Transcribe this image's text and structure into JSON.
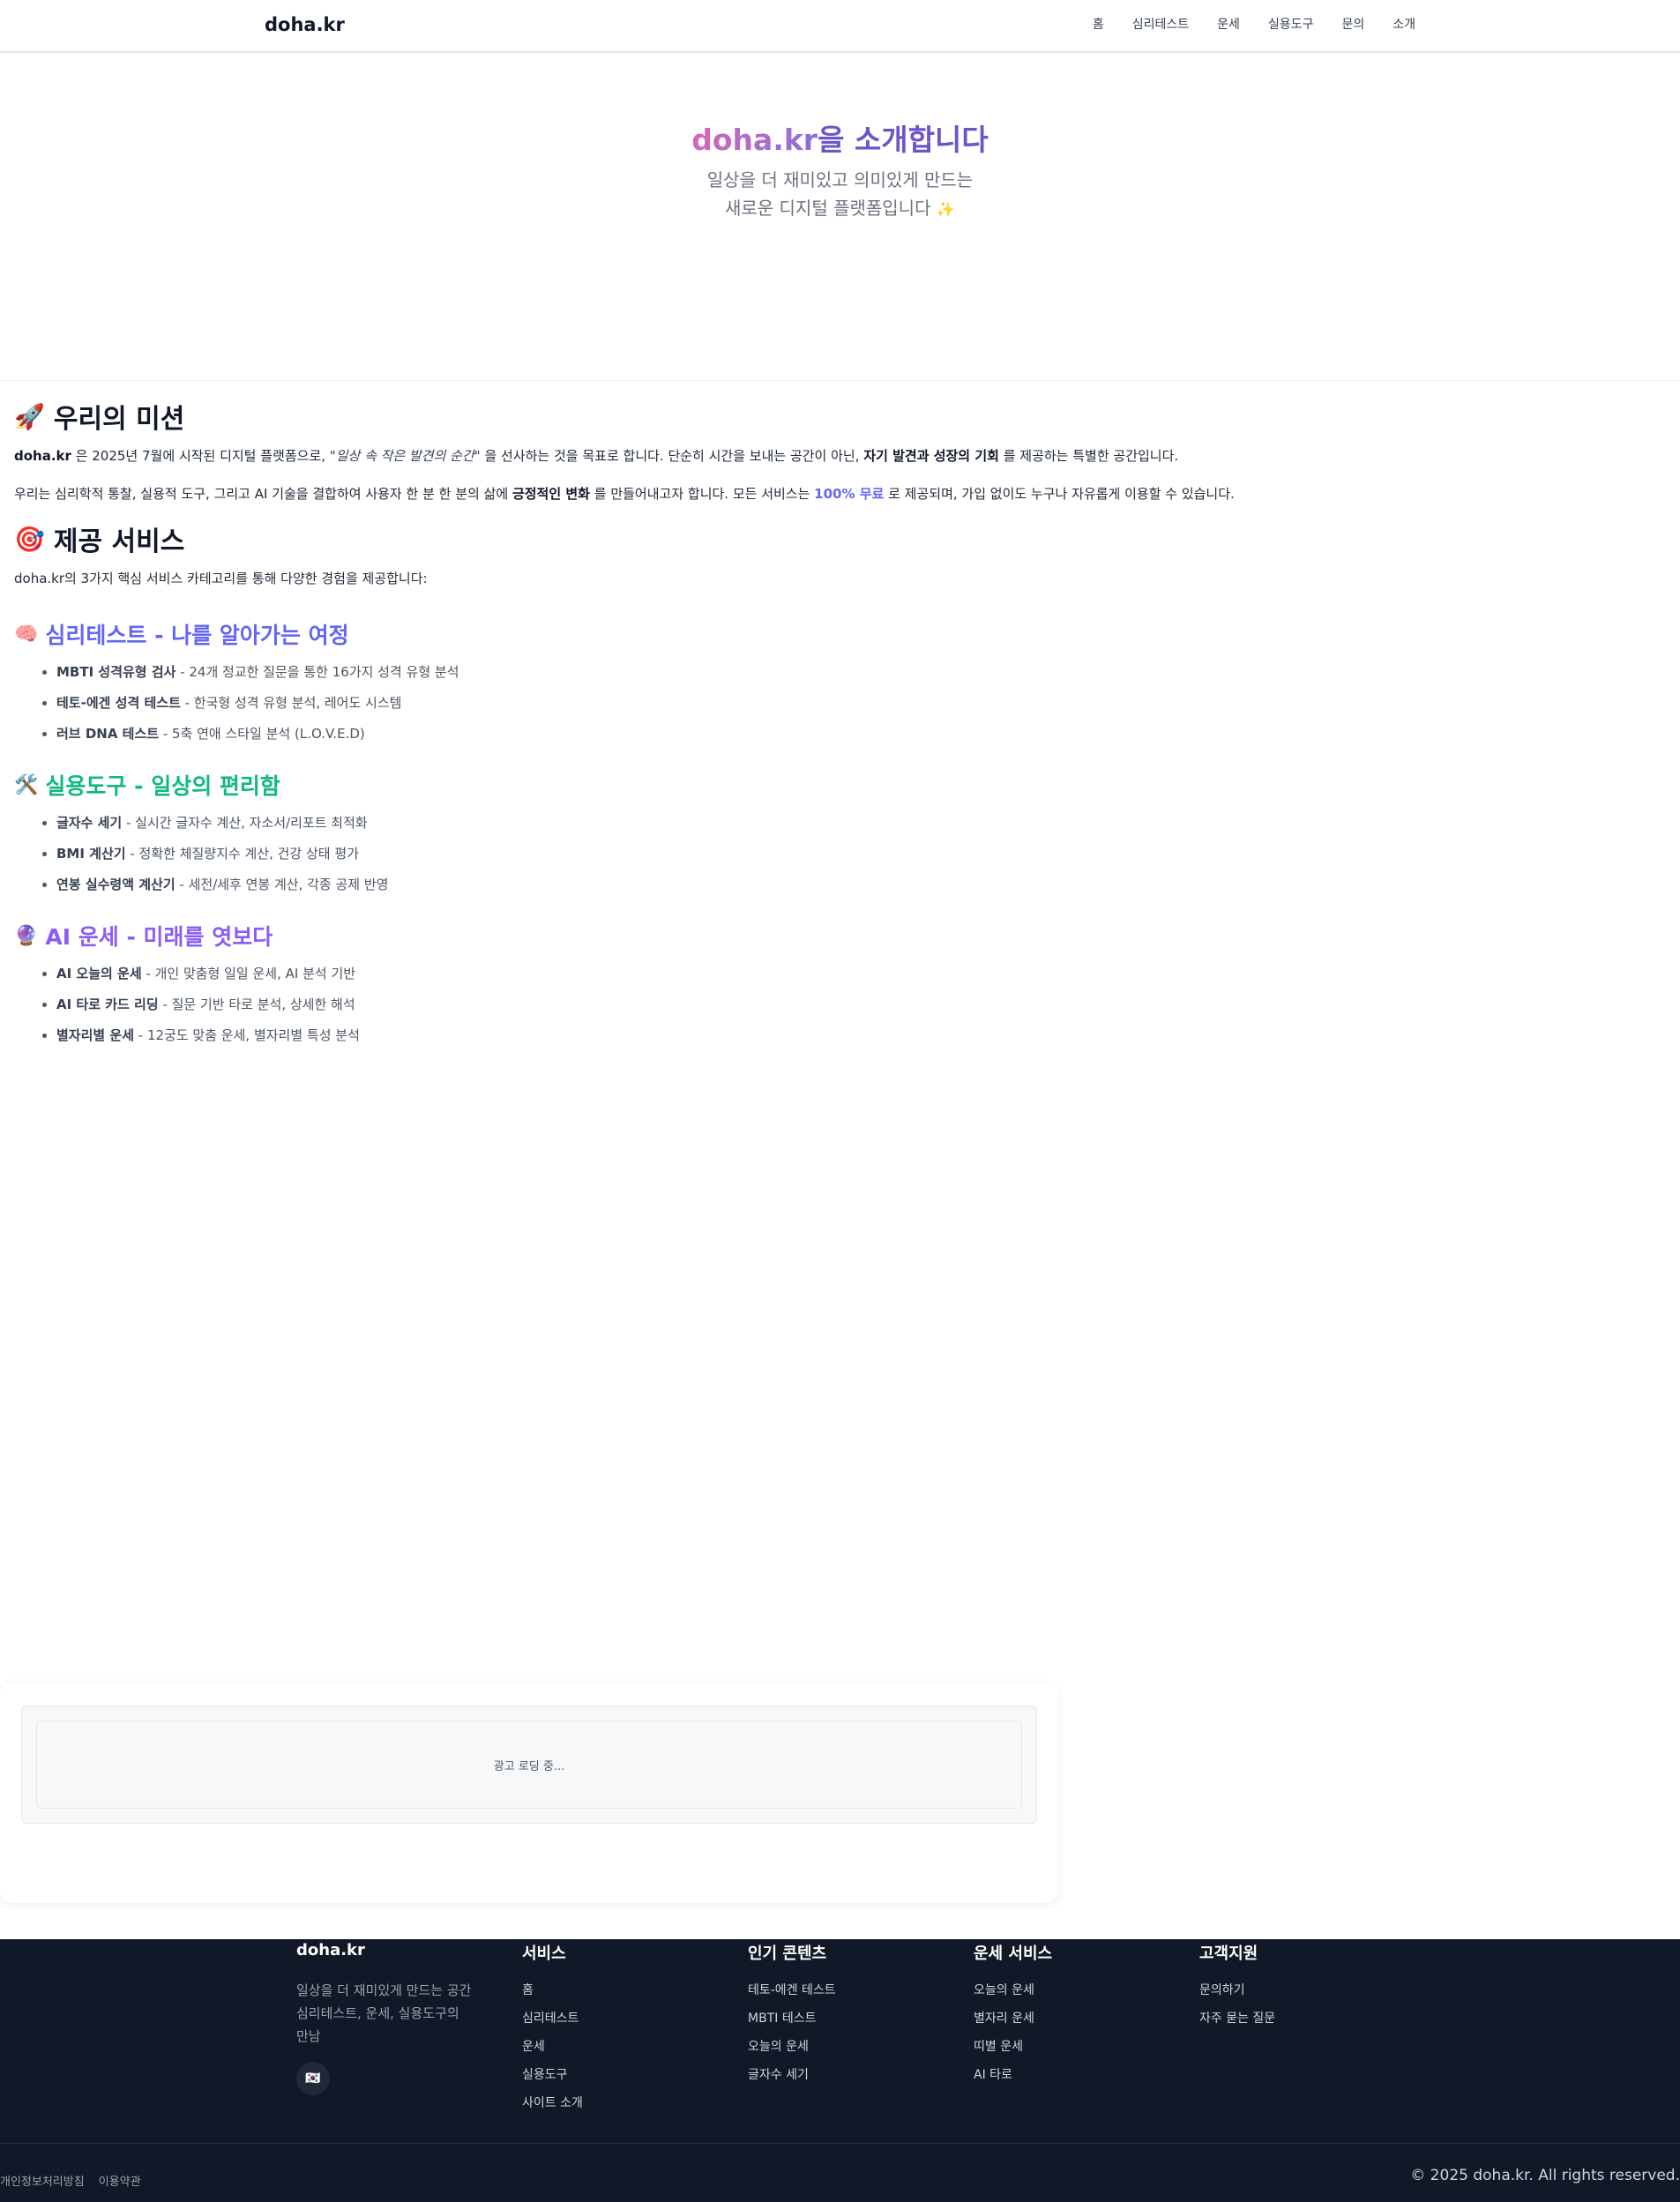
{
  "header": {
    "logo": "doha.kr",
    "nav": [
      "홈",
      "심리테스트",
      "운세",
      "실용도구",
      "문의",
      "소개"
    ]
  },
  "hero": {
    "title_brand": "doha.kr",
    "title_rest": "을 소개합니다",
    "subtitle_line1": "일상을 더 재미있고 의미있게 만드는",
    "subtitle_line2": "새로운 디지털 플랫폼입니다",
    "subtitle_emoji": "✨"
  },
  "mission": {
    "emoji": "🚀",
    "heading": "우리의 미션",
    "p1": {
      "brand": "doha.kr",
      "t1": " 은 2025년 7월에 시작된 디지털 플랫폼으로, ",
      "quote": "\"일상 속 작은 발견의 순간\"",
      "t2": " 을 선사하는 것을 목표로 합니다. 단순히 시간을 보내는 공간이 아닌, ",
      "bold": "자기 발견과 성장의 기회",
      "t3": " 를 제공하는 특별한 공간입니다."
    },
    "p2": {
      "t1": "우리는 심리학적 통찰, 실용적 도구, 그리고 AI 기술을 결합하여 사용자 한 분 한 분의 삶에 ",
      "bold": "긍정적인 변화",
      "t2": " 를 만들어내고자 합니다. 모든 서비스는 ",
      "free": "100% 무료",
      "t3": " 로 제공되며, 가입 없이도 누구나 자유롭게 이용할 수 있습니다."
    }
  },
  "services": {
    "emoji": "🎯",
    "heading": "제공 서비스",
    "intro": "doha.kr의 3가지 핵심 서비스 카테고리를 통해 다양한 경험을 제공합니다:",
    "categories": [
      {
        "emoji": "🧠",
        "title": "심리테스트 - 나를 알아가는 여정",
        "color": "#6366f1",
        "items": [
          {
            "name": "MBTI 성격유형 검사",
            "desc": " - 24개 정교한 질문을 통한 16가지 성격 유형 분석"
          },
          {
            "name": "테토-에겐 성격 테스트",
            "desc": " - 한국형 성격 유형 분석, 레어도 시스템"
          },
          {
            "name": "러브 DNA 테스트",
            "desc": " - 5축 연애 스타일 분석 (L.O.V.E.D)"
          }
        ]
      },
      {
        "emoji": "🛠️",
        "title": "실용도구 - 일상의 편리함",
        "color": "#10b981",
        "items": [
          {
            "name": "글자수 세기",
            "desc": " - 실시간 글자수 계산, 자소서/리포트 최적화"
          },
          {
            "name": "BMI 계산기",
            "desc": " - 정확한 체질량지수 계산, 건강 상태 평가"
          },
          {
            "name": "연봉 실수령액 계산기",
            "desc": " - 세전/세후 연봉 계산, 각종 공제 반영"
          }
        ]
      },
      {
        "emoji": "🔮",
        "title": "AI 운세 - 미래를 엿보다",
        "color": "#8b5cf6",
        "items": [
          {
            "name": "AI 오늘의 운세",
            "desc": " - 개인 맞춤형 일일 운세, AI 분석 기반"
          },
          {
            "name": "AI 타로 카드 리딩",
            "desc": " - 질문 기반 타로 분석, 상세한 해석"
          },
          {
            "name": "별자리별 운세",
            "desc": " - 12궁도 맞춤 운세, 별자리별 특성 분석"
          }
        ]
      }
    ]
  },
  "ad": {
    "loading_text": "광고 로딩 중..."
  },
  "footer": {
    "brand": "doha.kr",
    "desc_line1": "일상을 더 재미있게 만드는 공간",
    "desc_line2": "심리테스트, 운세, 실용도구의",
    "desc_line3": "만남",
    "flag": "🇰🇷",
    "columns": [
      {
        "title": "서비스",
        "items": [
          "홈",
          "심리테스트",
          "운세",
          "실용도구",
          "사이트 소개"
        ]
      },
      {
        "title": "인기 콘텐츠",
        "items": [
          "테토-에겐 테스트",
          "MBTI 테스트",
          "오늘의 운세",
          "글자수 세기"
        ]
      },
      {
        "title": "운세 서비스",
        "items": [
          "오늘의 운세",
          "별자리 운세",
          "띠별 운세",
          "AI 타로"
        ]
      },
      {
        "title": "고객지원",
        "items": [
          "문의하기",
          "자주 묻는 질문"
        ]
      }
    ],
    "legal": [
      "개인정보처리방침",
      "이용약관"
    ],
    "copyright": "© 2025 doha.kr. All rights reserved."
  }
}
